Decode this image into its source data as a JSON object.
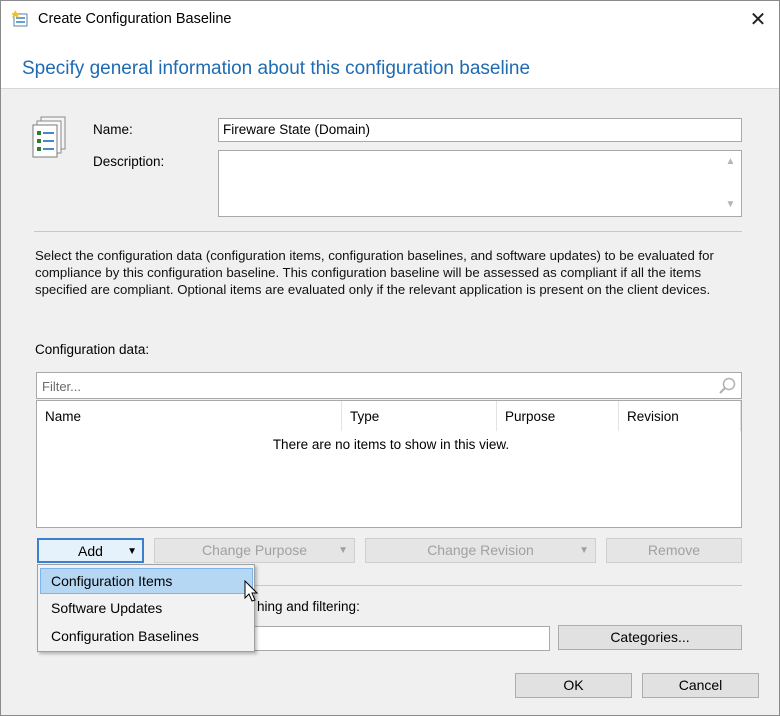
{
  "window": {
    "title": "Create Configuration Baseline",
    "close_glyph": "✕",
    "title_icon": "configuration-baseline-icon"
  },
  "header": {
    "title": "Specify general information about this configuration baseline"
  },
  "form": {
    "name_label": "Name:",
    "name_value": "Fireware State (Domain)",
    "description_label": "Description:",
    "description_value": ""
  },
  "info_text": "Select the configuration data (configuration items, configuration baselines, and software updates) to be evaluated for compliance by this configuration baseline. This configuration baseline will be assessed as compliant if all the items specified are compliant. Optional items are evaluated only if the relevant application is present on  the client devices.",
  "config_data": {
    "label": "Configuration data:",
    "filter_placeholder": "Filter...",
    "columns": [
      "Name",
      "Type",
      "Purpose",
      "Revision"
    ],
    "empty_message": "There are no items to show in this view."
  },
  "buttons": {
    "add": "Add",
    "change_purpose": "Change Purpose",
    "change_revision": "Change Revision",
    "remove": "Remove",
    "categories": "Categories...",
    "ok": "OK",
    "cancel": "Cancel"
  },
  "add_menu": {
    "items": [
      "Configuration Items",
      "Software Updates",
      "Configuration Baselines"
    ],
    "highlighted_index": 0
  },
  "categories_section": {
    "label_visible_fragment": "hing and filtering:"
  },
  "colors": {
    "header_title": "#1f6bb3",
    "dialog_bg": "#f0f0f0",
    "menu_highlight": "#b5d7f3",
    "focus_border": "#3c7fd0"
  }
}
